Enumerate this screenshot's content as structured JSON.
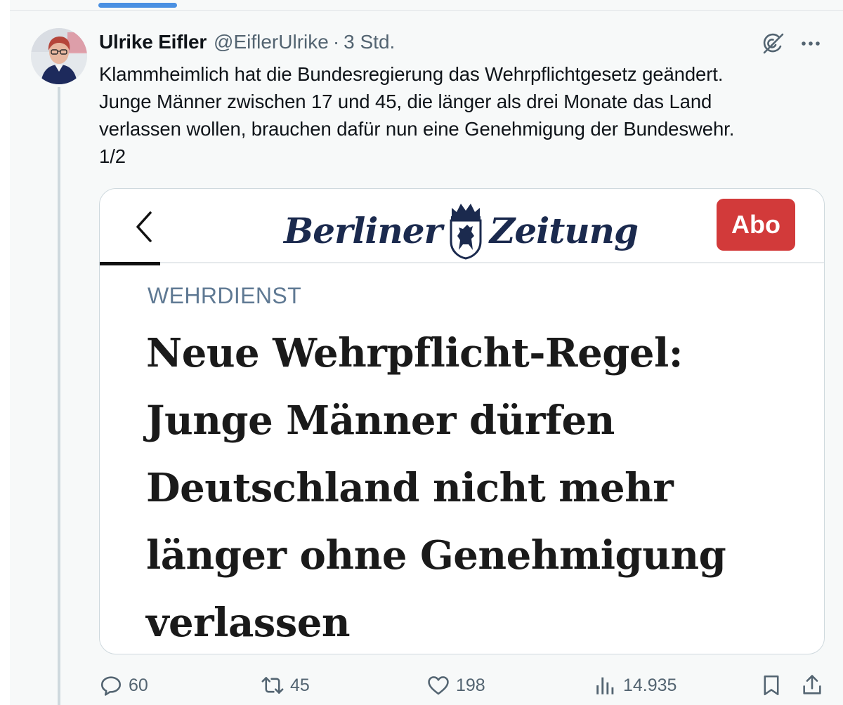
{
  "tweet": {
    "author_name": "Ulrike Eifler",
    "author_handle": "@EiflerUlrike",
    "separator": "·",
    "time": "3 Std.",
    "text": "Klammheimlich hat die Bundesregierung das Wehrpflichtgesetz geändert.\nJunge Männer zwischen 17 und 45, die länger als drei Monate das Land\nverlassen wollen, brauchen dafür nun eine Genehmigung der Bundeswehr.\n1/2"
  },
  "card": {
    "publication_left": "Berliner",
    "publication_right": "Zeitung",
    "subscribe_label": "Abo",
    "kicker": "WEHRDIENST",
    "headline": "Neue Wehrpflicht-Regel:\nJunge Männer dürfen\nDeutschland nicht mehr\nlänger ohne Genehmigung\nverlassen"
  },
  "actions": {
    "replies": "60",
    "reposts": "45",
    "likes": "198",
    "views": "14.935"
  },
  "icons": {
    "grok": "grok-icon",
    "more": "more-icon",
    "reply": "reply-icon",
    "repost": "repost-icon",
    "like": "heart-icon",
    "views": "views-icon",
    "bookmark": "bookmark-icon",
    "share": "share-icon",
    "back": "chevron-left-icon",
    "crest": "bear-crest-icon"
  },
  "colors": {
    "accent": "#4a90e2",
    "secondary_text": "#536471",
    "subscribe_button": "#d23a3a",
    "kicker": "#5f7993"
  }
}
